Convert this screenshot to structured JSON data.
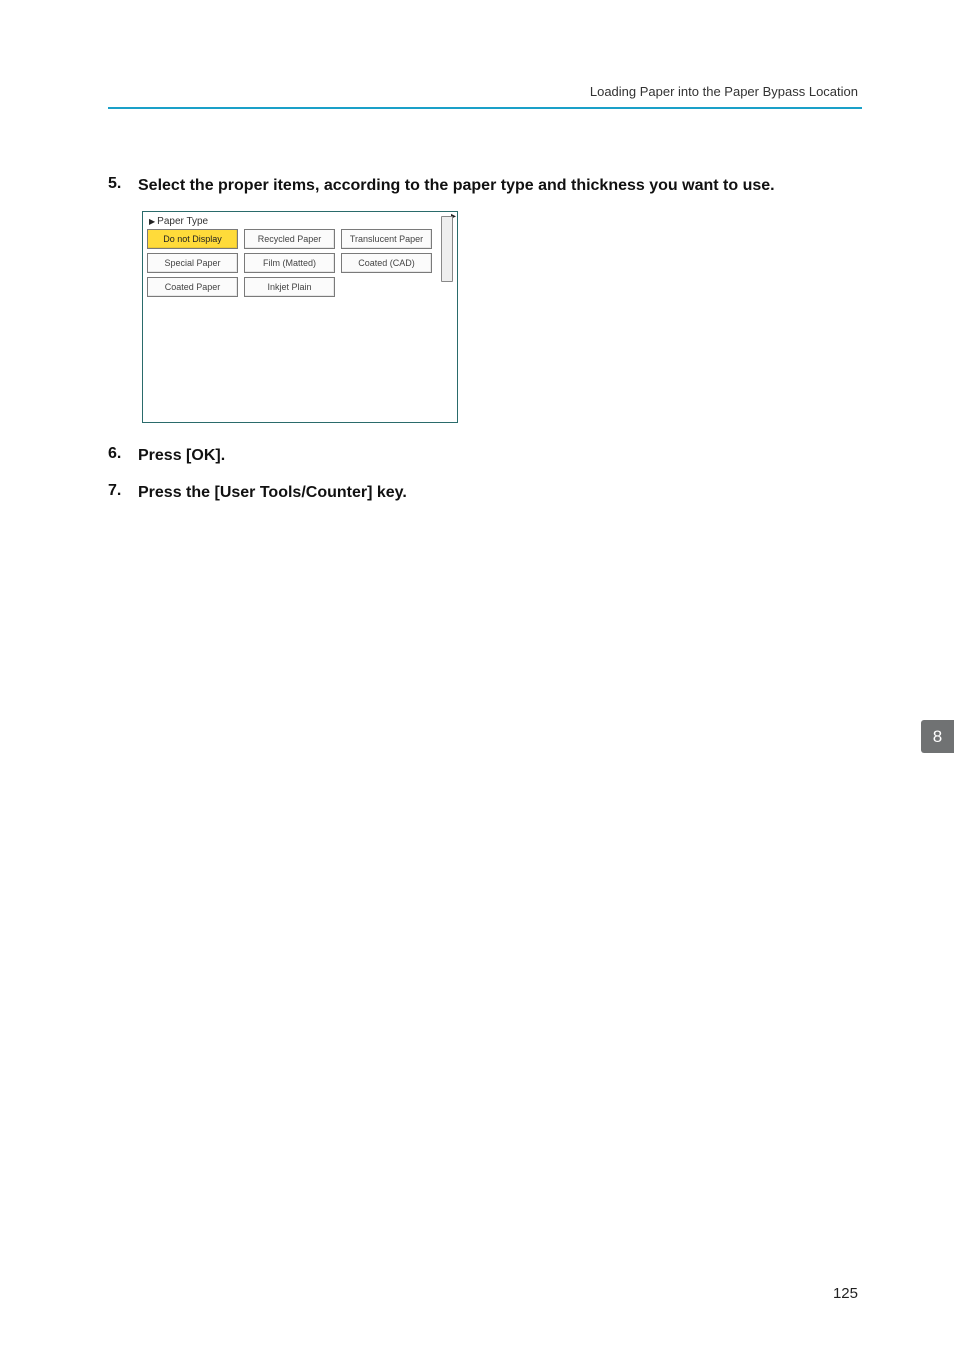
{
  "header": {
    "running_title": "Loading Paper into the Paper Bypass Location"
  },
  "steps": [
    {
      "num": "5.",
      "text": "Select the proper items, according to the paper type and thickness you want to use."
    },
    {
      "num": "6.",
      "text": "Press [OK]."
    },
    {
      "num": "7.",
      "text": "Press the [User Tools/Counter] key."
    }
  ],
  "screenshot": {
    "title": "Paper Type",
    "buttons": [
      {
        "label": "Do not Display",
        "selected": true
      },
      {
        "label": "Recycled Paper",
        "selected": false
      },
      {
        "label": "Translucent Paper",
        "selected": false
      },
      {
        "label": "Special Paper",
        "selected": false
      },
      {
        "label": "Film (Matted)",
        "selected": false
      },
      {
        "label": "Coated (CAD)",
        "selected": false
      },
      {
        "label": "Coated Paper",
        "selected": false
      },
      {
        "label": "Inkjet Plain",
        "selected": false
      }
    ]
  },
  "side_tab": "8",
  "page_number": "125"
}
